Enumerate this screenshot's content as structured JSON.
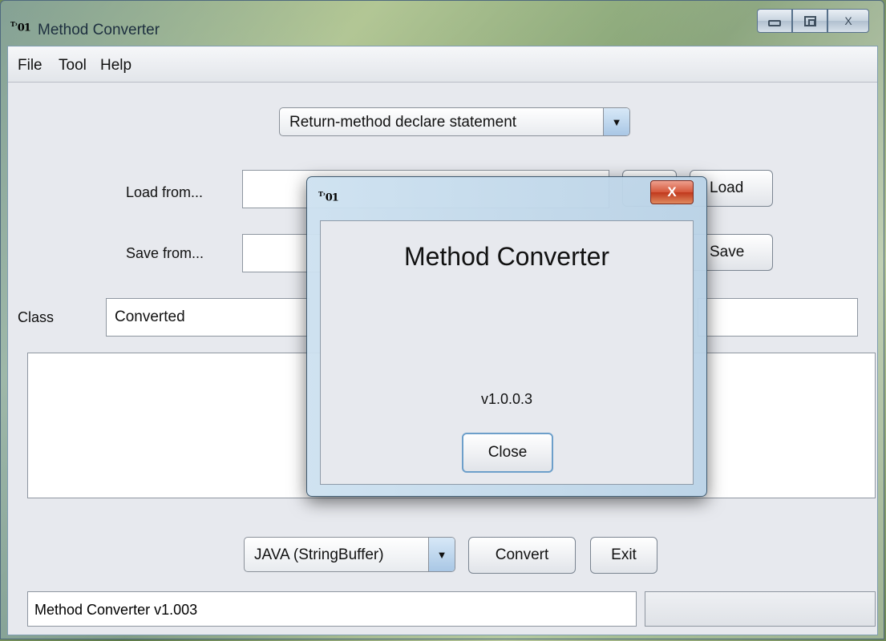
{
  "window": {
    "title": "Method Converter",
    "icon": "app-icon"
  },
  "menu": [
    "File",
    "Tool",
    "Help"
  ],
  "mode_select": {
    "value": "Return-method declare statement"
  },
  "load": {
    "label": "Load from...",
    "value": "",
    "button": "Load"
  },
  "save": {
    "label": "Save from...",
    "value": "",
    "button": "Save"
  },
  "class": {
    "label": "Class",
    "value": "Converted"
  },
  "language_select": {
    "value": "JAVA (StringBuffer)"
  },
  "buttons": {
    "convert": "Convert",
    "exit": "Exit"
  },
  "status": {
    "text": "Method Converter v1.003"
  },
  "dialog": {
    "title": "Method Converter",
    "version": "v1.0.0.3",
    "close_button": "Close",
    "close_glyph": "X"
  },
  "colors": {
    "accent": "#6d9fca",
    "close_red": "#c0381c"
  }
}
